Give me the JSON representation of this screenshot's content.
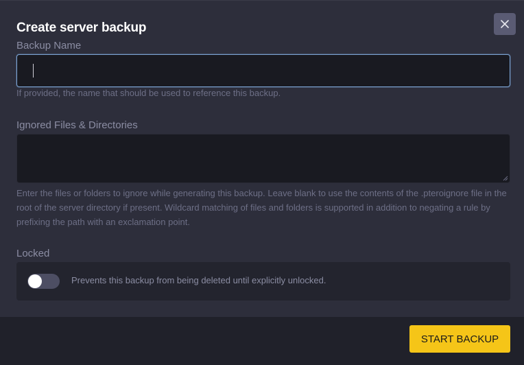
{
  "modal": {
    "title": "Create server backup",
    "close_icon": "close-icon"
  },
  "backup_name": {
    "label": "Backup Name",
    "value": "",
    "help": "If provided, the name that should be used to reference this backup."
  },
  "ignored": {
    "label": "Ignored Files & Directories",
    "value": "",
    "help": "Enter the files or folders to ignore while generating this backup. Leave blank to use the contents of the .pteroignore file in the root of the server directory if present. Wildcard matching of files and folders is supported in addition to negating a rule by prefixing the path with an exclamation point."
  },
  "locked": {
    "label": "Locked",
    "enabled": false,
    "description": "Prevents this backup from being deleted until explicitly unlocked."
  },
  "footer": {
    "start_label": "START BACKUP"
  },
  "colors": {
    "accent": "#f5c518",
    "focus_border": "#7ba3d3",
    "background": "#2d2e3b"
  }
}
